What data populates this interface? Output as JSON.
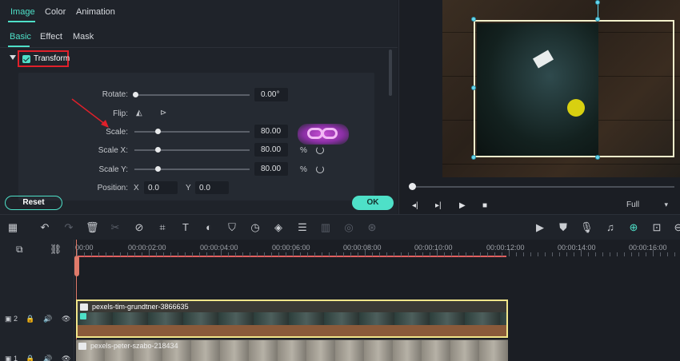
{
  "panel": {
    "tabs": [
      "Image",
      "Color",
      "Animation"
    ],
    "subtabs": [
      "Basic",
      "Effect",
      "Mask"
    ],
    "section_title": "Transform",
    "rotate": {
      "label": "Rotate:",
      "value": "0.00°",
      "fraction": 0.0
    },
    "flip": {
      "label": "Flip:"
    },
    "scale": {
      "label": "Scale:",
      "value": "80.00",
      "fraction": 0.2
    },
    "scale_x": {
      "label": "Scale X:",
      "value": "80.00",
      "unit": "%",
      "fraction": 0.2
    },
    "scale_y": {
      "label": "Scale Y:",
      "value": "80.00",
      "unit": "%",
      "fraction": 0.2
    },
    "position": {
      "label": "Position:",
      "x_label": "X",
      "x_value": "0.0",
      "y_label": "Y",
      "y_value": "0.0"
    },
    "reset_label": "Reset",
    "ok_label": "OK"
  },
  "preview": {
    "quality": "Full",
    "progress_fraction": 0.0
  },
  "toolbar": {
    "icons": [
      "undo-icon",
      "redo-icon",
      "delete-icon",
      "cut-icon",
      "split-icon",
      "crop-icon",
      "text-icon",
      "color-icon",
      "stabilize-icon",
      "speed-icon",
      "keyframe-icon",
      "adjust-icon",
      "audio-icon",
      "motion-icon",
      "effects-icon",
      "render-icon",
      "marker-icon",
      "voiceover-icon",
      "audio-mixer-icon",
      "snap-icon",
      "fit-icon",
      "zoom-out-icon"
    ]
  },
  "timeline": {
    "ruler": [
      "00:00",
      "00:00:02:00",
      "00:00:04:00",
      "00:00:06:00",
      "00:00:08:00",
      "00:00:10:00",
      "00:00:12:00",
      "00:00:14:00",
      "00:00:16:00"
    ],
    "tracks": [
      {
        "number": "2",
        "clip_name": "pexels-tim-grundtner-3866635"
      },
      {
        "number": "1",
        "clip_name": "pexels-peter-szabo-218434"
      }
    ]
  },
  "colors": {
    "accent": "#4ee0c8",
    "highlight_box": "#e0202a",
    "playhead": "#e07a6a",
    "selected_clip_border": "#f0e58a"
  }
}
